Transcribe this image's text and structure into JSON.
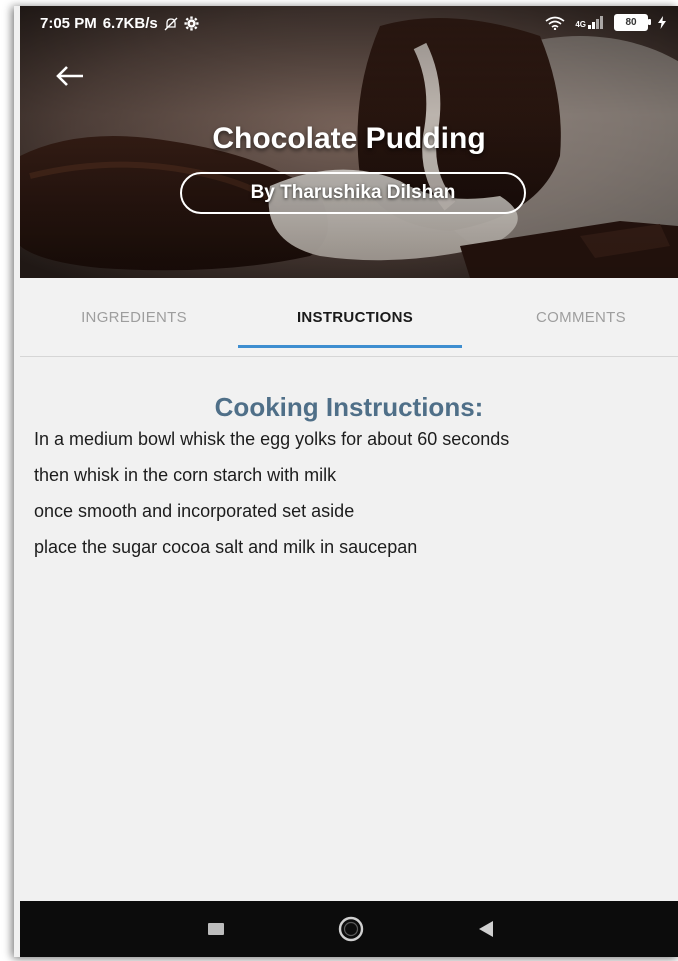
{
  "status_bar": {
    "time": "7:05 PM",
    "speed": "6.7KB/s",
    "network": "4G",
    "battery": "80"
  },
  "recipe": {
    "title": "Chocolate Pudding",
    "author": "By Tharushika Dilshan"
  },
  "tabs": [
    {
      "label": "INGREDIENTS",
      "active": false
    },
    {
      "label": "INSTRUCTIONS",
      "active": true
    },
    {
      "label": "COMMENTS",
      "active": false
    }
  ],
  "instructions": {
    "heading": "Cooking Instructions:",
    "steps": [
      "In a medium bowl whisk the egg yolks for about 60 seconds",
      "then whisk in the corn starch with milk",
      "once smooth and incorporated set aside",
      "place the sugar cocoa salt and milk in saucepan"
    ]
  },
  "colors": {
    "accent": "#3e8ed0",
    "heading": "#4f6f88",
    "navbar": "#0c0c0c"
  },
  "icons": {
    "back": "arrow-left-icon",
    "silent": "bell-off-icon",
    "settings": "gear-icon",
    "wifi": "wifi-icon",
    "signal": "signal-icon",
    "battery": "battery-icon",
    "charging": "bolt-icon"
  }
}
